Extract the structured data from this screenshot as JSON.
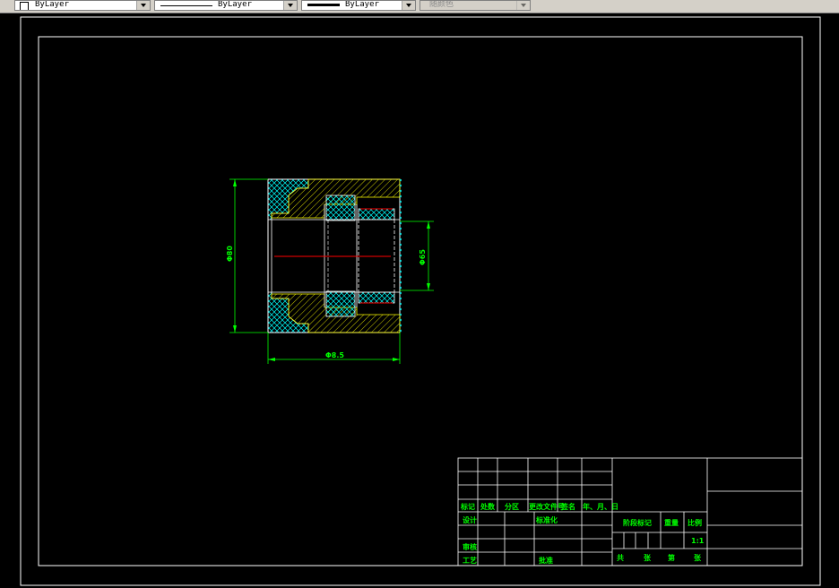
{
  "toolbar": {
    "color_combo": "ByLayer",
    "linetype_combo": "ByLayer",
    "lineweight_combo": "ByLayer",
    "plotstyle_combo": "随颜色"
  },
  "drawing": {
    "dim_height": "Φ80",
    "dim_bore": "Φ65",
    "dim_length": "Φ8.5"
  },
  "title_block": {
    "row_labels": [
      "标记",
      "处数",
      "分区",
      "更改文件号",
      "签名",
      "年、月、日"
    ],
    "design": "设计",
    "standardize": "标准化",
    "review": "审核",
    "process": "工艺",
    "approve": "批准",
    "stage_mark": "阶段标记",
    "weight": "重量",
    "scale": "比例",
    "scale_value": "1:1",
    "total": "共",
    "sheet": "张",
    "page": "第",
    "sheet2": "张"
  },
  "colors": {
    "background": "#000000",
    "frame": "#ffffff",
    "title_text": "#00ff00",
    "hatch": "#00ffff",
    "section": "#ffff00",
    "centerline": "#ff0000"
  }
}
